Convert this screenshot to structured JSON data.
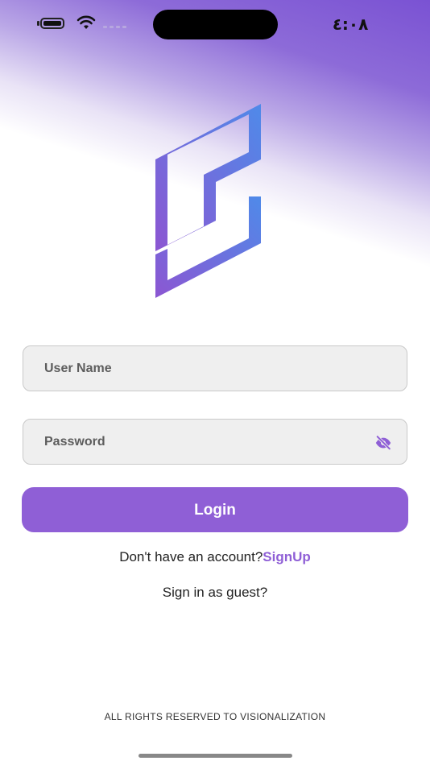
{
  "status_bar": {
    "time": "٤:٠٨"
  },
  "logo": {
    "gradient_start": "#4f8ae9",
    "gradient_end": "#8c56d2"
  },
  "form": {
    "username_placeholder": "User Name",
    "password_placeholder": "Password"
  },
  "actions": {
    "login_label": "Login",
    "no_account_text": "Don't have an account?",
    "signup_label": "SignUp",
    "guest_label": "Sign in as guest?"
  },
  "footer": {
    "text": "ALL RIGHTS RESERVED TO VISIONALIZATION"
  },
  "colors": {
    "accent": "#8f5fd6",
    "field_background": "#efefef"
  },
  "icons": {
    "password_toggle": "eye-off-icon"
  }
}
